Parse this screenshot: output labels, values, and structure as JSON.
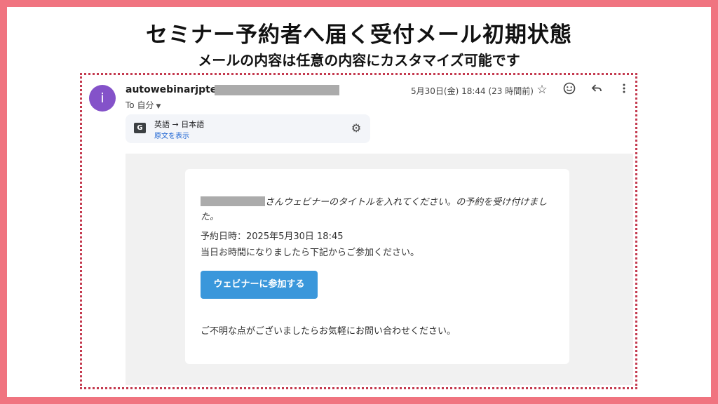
{
  "slide": {
    "headline": "セミナー予約者へ届く受付メール初期状態",
    "subheadline": "メールの内容は任意の内容にカスタマイズ可能です"
  },
  "email": {
    "avatar_letter": "i",
    "sender_name": "autowebinarjptest",
    "to_label": "To 自分",
    "date": "5月30日(金) 18:44 (23 時間前)",
    "icons": {
      "star": "star-icon",
      "emoji": "emoji-icon",
      "reply": "reply-icon",
      "more": "more-vert-icon",
      "translate": "translate-icon",
      "settings": "gear-icon",
      "caret": "caret-down-icon"
    },
    "translate": {
      "lang": "英語 → 日本語",
      "show_original": "原文を表示"
    },
    "body": {
      "greeting": "さんウェビナーのタイトルを入れてください。の予約を受け付けました。",
      "datetime": "予約日時：2025年5月30日 18:45",
      "instruction": "当日お時間になりましたら下記からご参加ください。",
      "button_label": "ウェビナーに参加する",
      "footer": "ご不明な点がございましたらお気軽にお問い合わせください。"
    }
  },
  "colors": {
    "background": "#f07480",
    "frame": "#c43a4f",
    "avatar": "#8452c9",
    "button": "#3a97db",
    "link": "#1a62d2"
  }
}
